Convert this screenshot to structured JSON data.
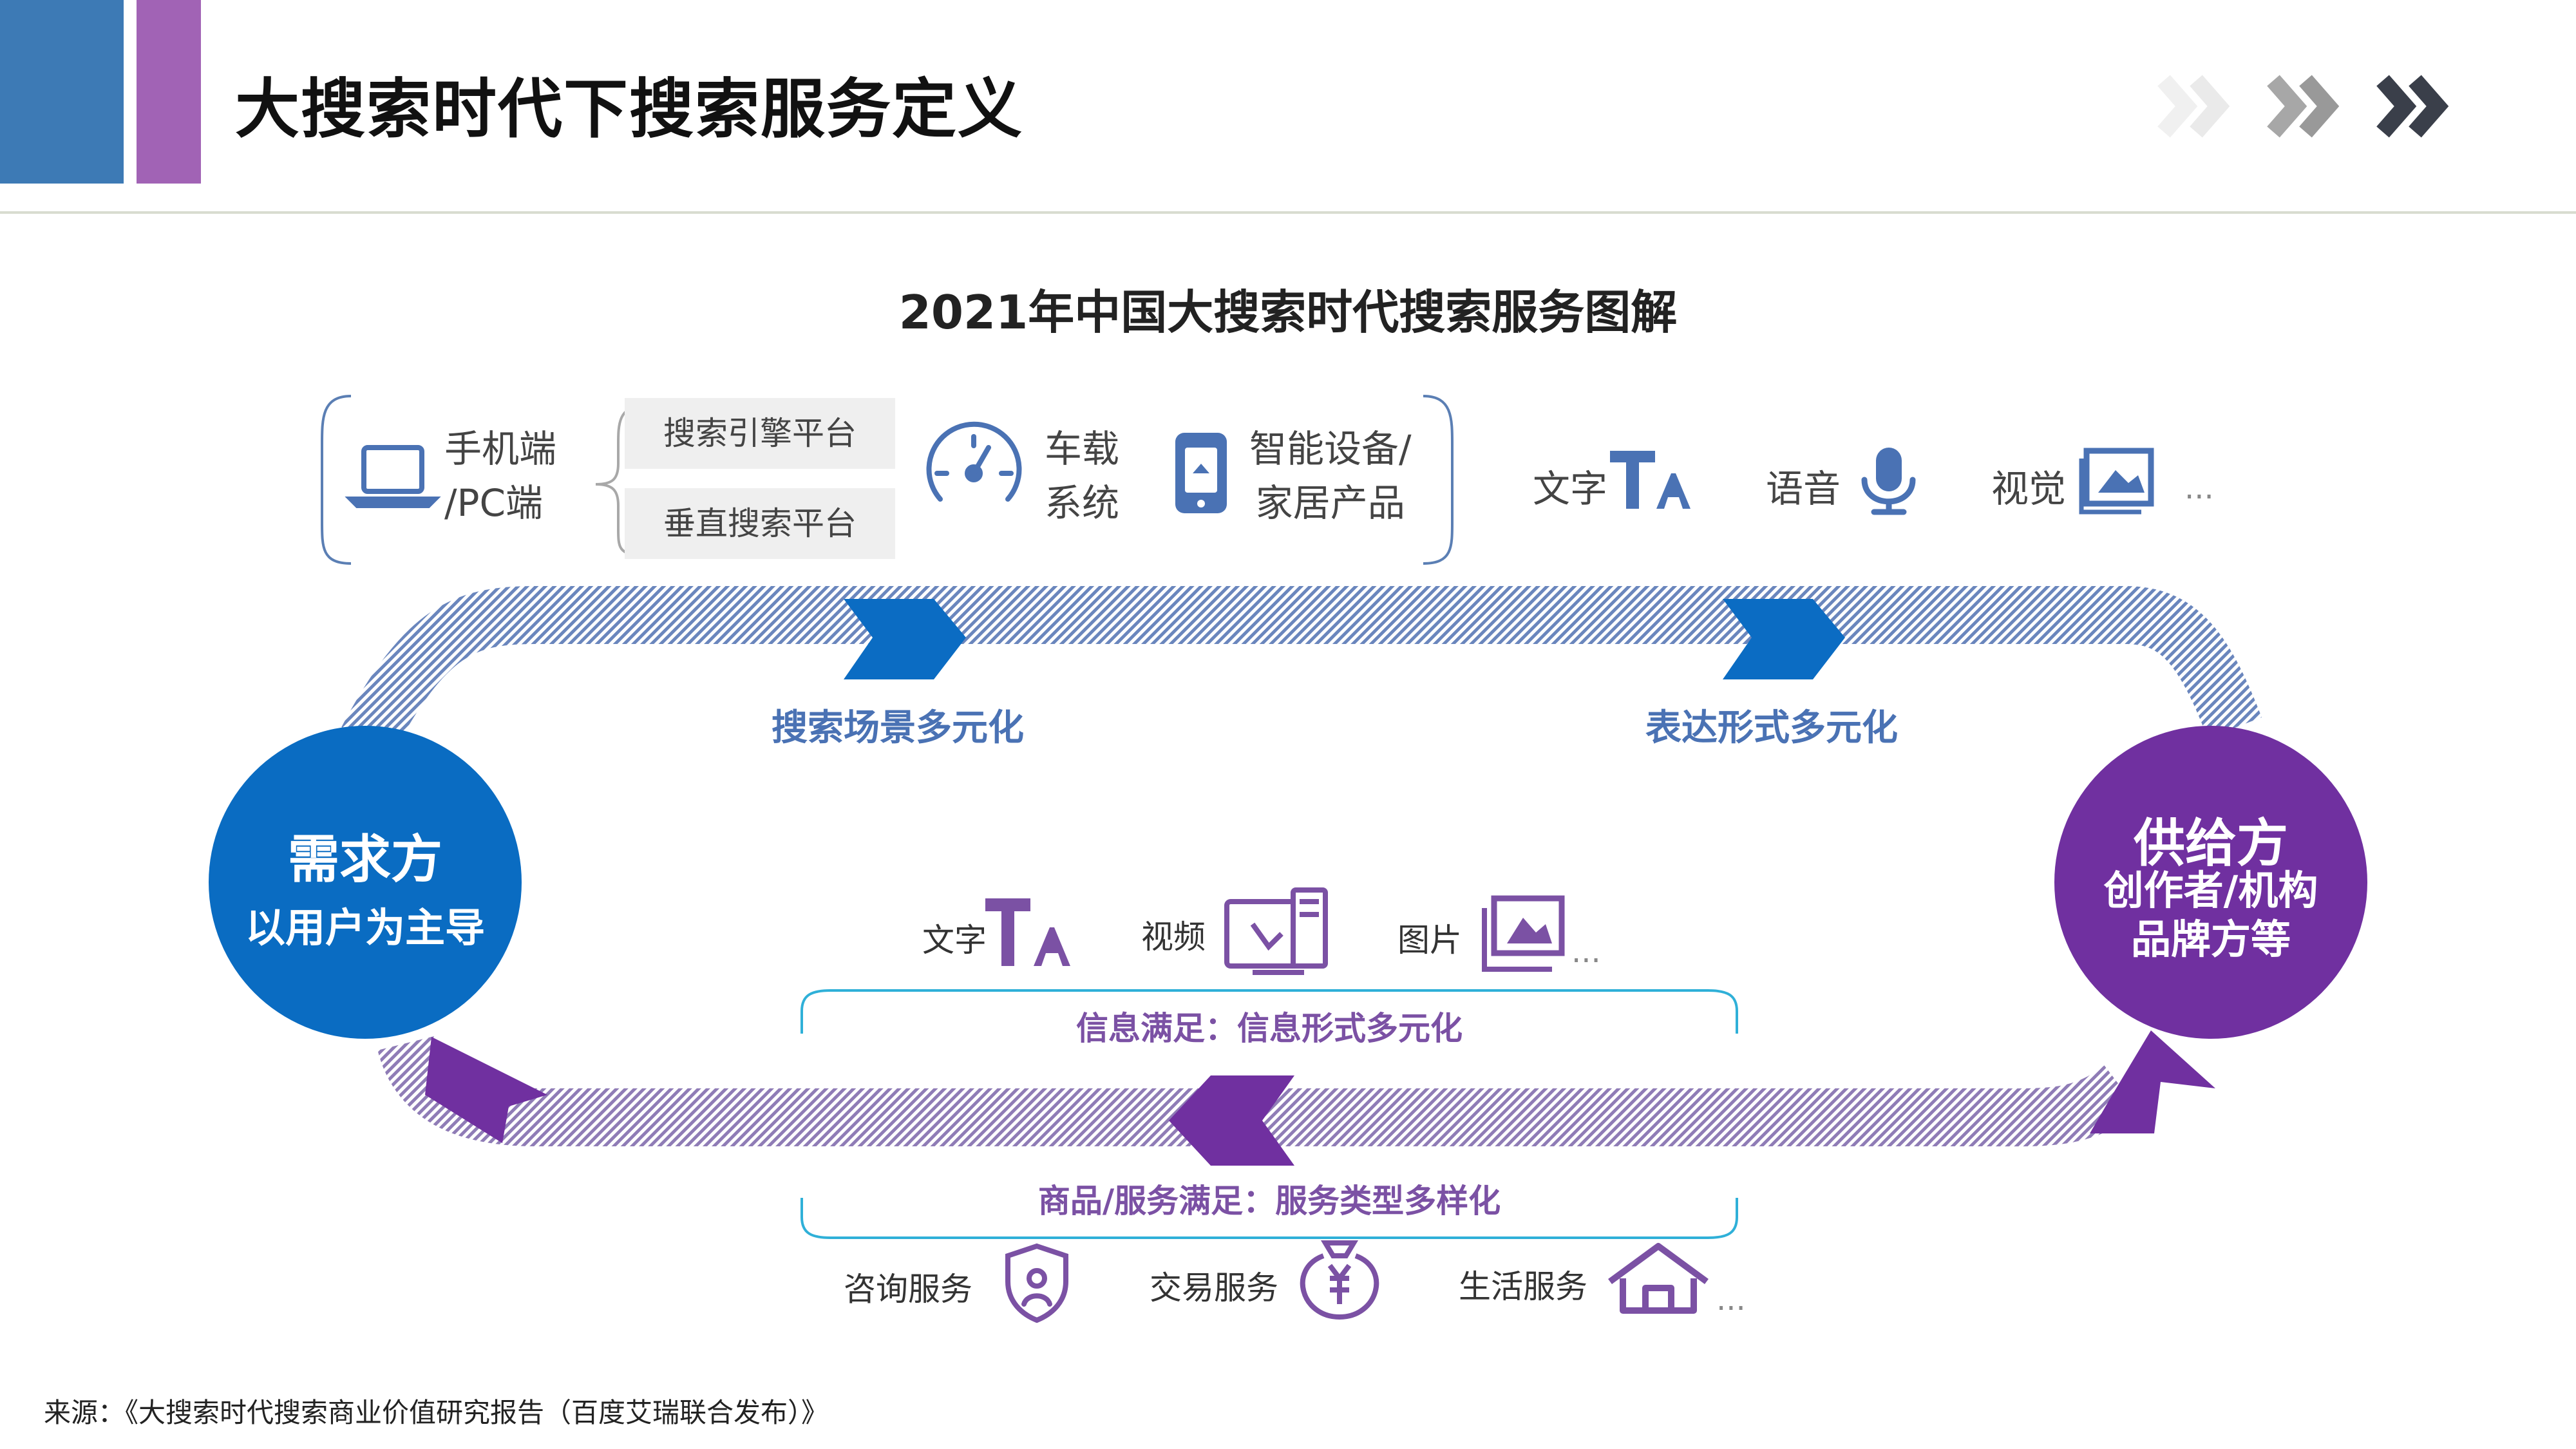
{
  "header": {
    "title": "大搜索时代下搜索服务定义",
    "colors": {
      "blue_bar": "#3d7ab5",
      "purple_bar": "#a163b5"
    },
    "icons": [
      "chevrons-right-icon"
    ]
  },
  "diagram": {
    "title": "2021年中国大搜索时代搜索服务图解",
    "top_group": {
      "device_label_lines": [
        "手机端",
        "/PC端"
      ],
      "platforms": [
        "搜索引擎平台",
        "垂直搜索平台"
      ],
      "car_label_lines": [
        "车载",
        "系统"
      ],
      "smart_label_lines": [
        "智能设备/",
        "家居产品"
      ],
      "icons": [
        "laptop-icon",
        "speedometer-icon",
        "smart-device-icon"
      ]
    },
    "formats_top": {
      "items": [
        "文字",
        "语音",
        "视觉"
      ],
      "ellipsis": "...",
      "icons": [
        "text-format-icon",
        "microphone-icon",
        "image-gallery-icon"
      ]
    },
    "flow": {
      "top_left_label": "搜索场景多元化",
      "top_right_label": "表达形式多元化",
      "colors": {
        "blue": "#0b6cc3",
        "purple": "#7030a0",
        "blue_stripes": "#6a86bd",
        "purple_stripes": "#8f7cb6"
      }
    },
    "demand": {
      "title": "需求方",
      "subtitle": "以用户为主导",
      "color": "#0a6cc2"
    },
    "supply": {
      "title": "供给方",
      "subtitle_lines": [
        "创作者/机构",
        "品牌方等"
      ],
      "color": "#7030a0"
    },
    "info": {
      "items": [
        "文字",
        "视频",
        "图片"
      ],
      "ellipsis": "...",
      "label": "信息满足：信息形式多元化",
      "icons": [
        "text-format-icon",
        "video-screen-icon",
        "picture-icon"
      ]
    },
    "goods": {
      "label": "商品/服务满足：服务类型多样化",
      "items": [
        "咨询服务",
        "交易服务",
        "生活服务"
      ],
      "ellipsis": "...",
      "icons": [
        "consult-shield-icon",
        "money-bag-icon",
        "house-icon"
      ]
    }
  },
  "footer": {
    "source": "来源：《大搜索时代搜索商业价值研究报告（百度艾瑞联合发布）》"
  }
}
